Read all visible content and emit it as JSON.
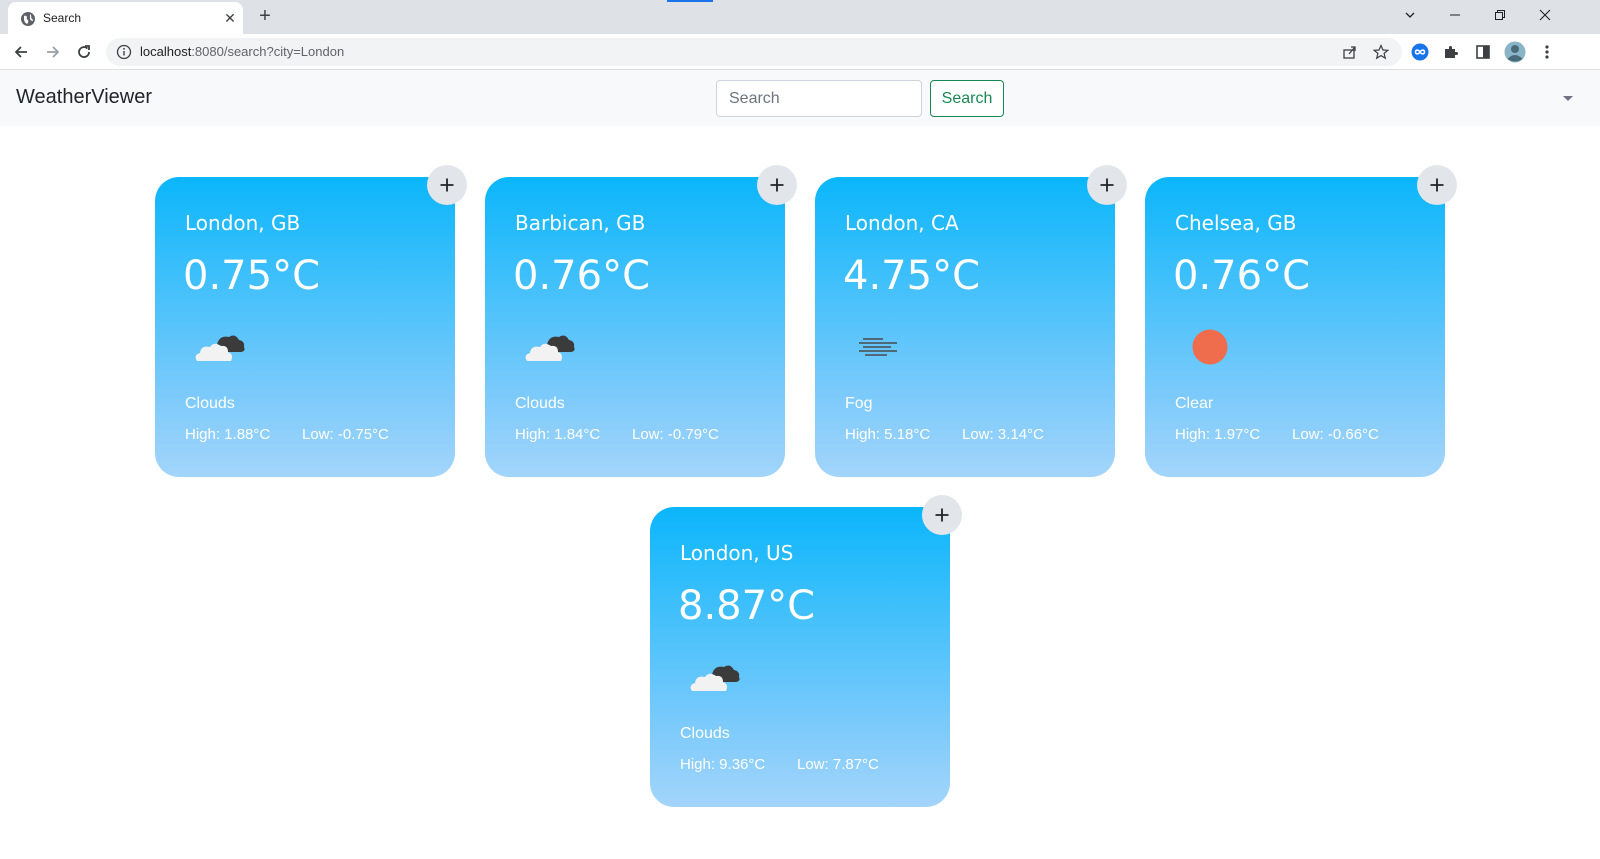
{
  "browser": {
    "tab_title": "Search",
    "url_host": "localhost",
    "url_path": ":8080/search?city=London"
  },
  "app": {
    "brand": "WeatherViewer",
    "search_placeholder": "Search",
    "search_button": "Search"
  },
  "cards": [
    {
      "location": "London, GB",
      "temperature": "0.75°C",
      "condition": "Clouds",
      "high": "High: 1.88°C",
      "low": "Low: -0.75°C",
      "icon": "clouds-icon"
    },
    {
      "location": "Barbican, GB",
      "temperature": "0.76°C",
      "condition": "Clouds",
      "high": "High: 1.84°C",
      "low": "Low: -0.79°C",
      "icon": "clouds-icon"
    },
    {
      "location": "London, CA",
      "temperature": "4.75°C",
      "condition": "Fog",
      "high": "High: 5.18°C",
      "low": "Low: 3.14°C",
      "icon": "fog-icon"
    },
    {
      "location": "Chelsea, GB",
      "temperature": "0.76°C",
      "condition": "Clear",
      "high": "High: 1.97°C",
      "low": "Low: -0.66°C",
      "icon": "sun-icon"
    },
    {
      "location": "London, US",
      "temperature": "8.87°C",
      "condition": "Clouds",
      "high": "High: 9.36°C",
      "low": "Low: 7.87°C",
      "icon": "clouds-icon"
    }
  ],
  "colors": {
    "card_gradient_top": "#0bb6fb",
    "card_gradient_bottom": "#a3d5fb",
    "sun": "#ef6c4c",
    "search_button": "#198754"
  }
}
